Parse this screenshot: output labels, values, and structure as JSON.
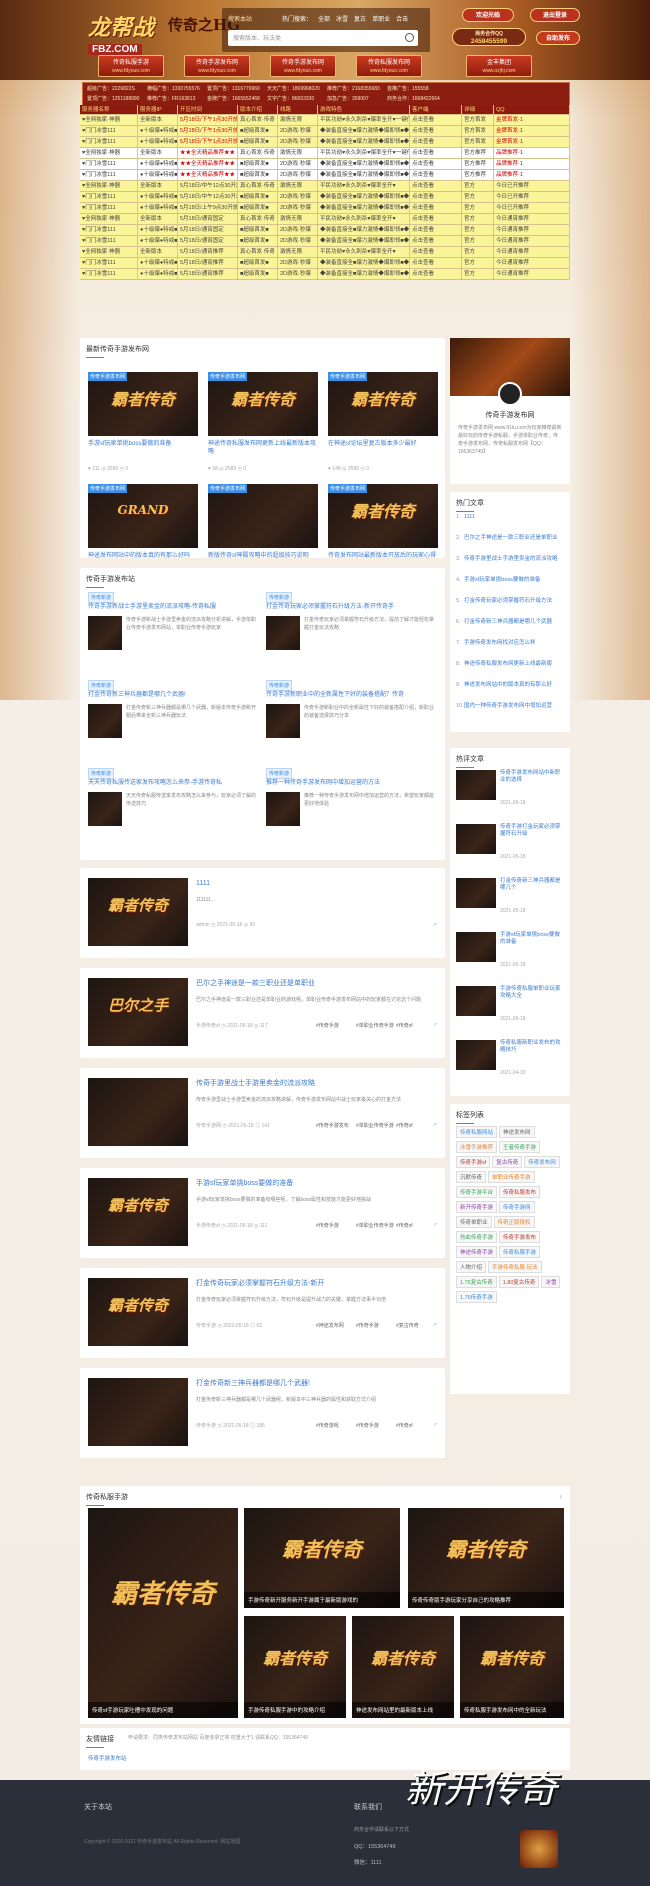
{
  "header": {
    "logo_text": "龙帮战",
    "logo_sub": "FBZ.COM",
    "logo2_text": "传奇之HG",
    "search_tab": "搜索本站",
    "hot_links": [
      "热门搜索：",
      "全部",
      "冰雪",
      "复古",
      "单职业",
      "合击"
    ],
    "search_placeholder": "搜索版本、玩法类",
    "btn_top": "欢迎光临",
    "btn_exit": "退出登录",
    "qq_label": "商务合作QQ",
    "qq_number": "2458455599",
    "btn_publish": "自助发布"
  },
  "nav": [
    {
      "label": "传奇私服手游",
      "url": "www.fdyouo.com"
    },
    {
      "label": "传奇手游发布网",
      "url": "www.fdyouo.com"
    },
    {
      "label": "传奇手游发布网",
      "url": "www.fdyouo.com"
    },
    {
      "label": "传奇私服发布网",
      "url": "www.fdyouo.com"
    },
    {
      "label": "金丰集团",
      "url": "www.ozjhj.com"
    }
  ],
  "ads": [
    [
      "超级广告：2226822S",
      "横幅广告：1330755576",
      "置顶广告：1316779969",
      "天天广告：1869968029",
      "推荐广告：2168355683",
      "首推广告：155558"
    ],
    [
      "置顶广告：1251188990",
      "推荐广告：FR163813",
      "金牌广告：1665552468",
      "文字广告：86653330",
      "加急广告：359007",
      "商务合作：1668422664"
    ]
  ],
  "table": {
    "headers": [
      "服务器名称",
      "服务器IP",
      "开区时间",
      "版本介绍",
      "线路",
      "游戏特色",
      "客户端",
      "详细",
      "QQ"
    ],
    "rows": [
      {
        "bg": "y",
        "cells": [
          "♥全网独家·神器",
          "全新版本",
          "5月18日/下午1点30开放",
          "真心首发·传奇",
          "激情无限",
          "平民功勋♥永久刺杀♥爆率全开♥一键传",
          "点击查看",
          "官方首发",
          "金牌首发·1"
        ],
        "red": true
      },
      {
        "bg": "y",
        "cells": [
          "♥门门冰雪111",
          "●十级爆●特戒■",
          "5月18日/下午1点30开放",
          "■超级首发■",
          "2D游戏·秒爆",
          "◆装备直接全■爆力激情◆爆即领■◆一键传",
          "点击查看",
          "官方首发",
          "金牌首发·1"
        ],
        "red": true
      },
      {
        "bg": "y",
        "cells": [
          "♥门门冰雪111",
          "●十级爆●特戒■",
          "5月18日/下午1点30开放",
          "■超级首发■",
          "2D游戏·秒爆",
          "◆装备直接全■爆力激情◆爆即领■◆一键传",
          "点击查看",
          "官方首发",
          "金牌首发·1"
        ],
        "red": true
      },
      {
        "bg": "w",
        "cells": [
          "♥全网独家·神器",
          "全新版本",
          "★★全天精品推荐★★",
          "真心首发·传奇",
          "激情无限",
          "平民功勋♥永久刺杀♥爆率全开♥一键传",
          "点击查看",
          "官方推荐",
          "品牌推荐·1"
        ],
        "red": true
      },
      {
        "bg": "w",
        "cells": [
          "♥门门冰雪111",
          "●十级爆●特戒■",
          "★★全天精品推荐★★",
          "■超级首发■",
          "2D游戏·秒爆",
          "◆装备直接全■爆力激情◆爆即领■◆一键传",
          "点击查看",
          "官方推荐",
          "品牌推荐·1"
        ],
        "red": true
      },
      {
        "bg": "w",
        "cells": [
          "♥门门冰雪111",
          "●十级爆●特戒■",
          "★★全天精品推荐★★",
          "■超级首发■",
          "2D游戏·秒爆",
          "◆装备直接全■爆力激情◆爆即领■◆一键传",
          "点击查看",
          "官方推荐",
          "品牌推荐·1"
        ],
        "red": true
      },
      {
        "bg": "y",
        "cells": [
          "♥全网独家·神器",
          "全新版本",
          "5月18日/中午12点30开放",
          "真心首发·传奇",
          "激情无限",
          "平民功勋♥永久刺杀♥爆率全开♥",
          "点击查看",
          "官方",
          "今日已开推荐"
        ],
        "red": false
      },
      {
        "bg": "y",
        "cells": [
          "♥门门冰雪111",
          "●十级爆●特戒■",
          "5月18日/中午12点30开放",
          "■超级首发■",
          "2D游戏·秒爆",
          "◆装备直接全■爆力激情◆爆即领■◆",
          "点击查看",
          "官方",
          "今日已开推荐"
        ],
        "red": false
      },
      {
        "bg": "y",
        "cells": [
          "♥门门冰雪111",
          "●十级爆●特戒■",
          "5月18日/上午9点30开放",
          "■超级首发■",
          "2D游戏·秒爆",
          "◆装备直接全■爆力激情◆爆即领■◆",
          "点击查看",
          "官方",
          "今日已开推荐"
        ],
        "red": false
      },
      {
        "bg": "y",
        "cells": [
          "♥全网独家·神器",
          "全新版本",
          "5月18日/通宵固定",
          "真心首发·传奇",
          "激情无限",
          "平民功勋♥永久刺杀♥爆率全开♥",
          "点击查看",
          "官方",
          "今日通宵推荐"
        ],
        "red": false
      },
      {
        "bg": "y",
        "cells": [
          "♥门门冰雪111",
          "●十级爆●特戒■",
          "5月18日/通宵固定",
          "■超级首发■",
          "2D游戏·秒爆",
          "◆装备直接全■爆力激情◆爆即领■◆",
          "点击查看",
          "官方",
          "今日通宵推荐"
        ],
        "red": false
      },
      {
        "bg": "y",
        "cells": [
          "♥门门冰雪111",
          "●十级爆●特戒■",
          "5月18日/通宵固定",
          "■超级首发■",
          "2D游戏·秒爆",
          "◆装备直接全■爆力激情◆爆即领■◆",
          "点击查看",
          "官方",
          "今日通宵推荐"
        ],
        "red": false
      },
      {
        "bg": "y",
        "cells": [
          "♥全网独家·神器",
          "全新版本",
          "5月18日/通宵推荐",
          "真心首发·传奇",
          "激情无限",
          "平民功勋♥永久刺杀♥爆率全开♥",
          "点击查看",
          "官方",
          "今日通宵推荐"
        ],
        "red": false
      },
      {
        "bg": "y",
        "cells": [
          "♥门门冰雪111",
          "●十级爆●特戒■",
          "5月18日/通宵推荐",
          "■超级首发■",
          "2D游戏·秒爆",
          "◆装备直接全■爆力激情◆爆即领■◆",
          "点击查看",
          "官方",
          "今日通宵推荐"
        ],
        "red": false
      },
      {
        "bg": "y",
        "cells": [
          "♥门门冰雪111",
          "●十级爆●特戒■",
          "5月18日/通宵推荐",
          "■超级首发■",
          "2D游戏·秒爆",
          "◆装备直接全■爆力激情◆爆即领■◆",
          "点击查看",
          "官方",
          "今日通宵推荐"
        ],
        "red": false
      }
    ]
  },
  "latest": {
    "title": "最新传奇手游发布网",
    "cards": [
      {
        "title": "手游sf玩家单挑boss要做的准备",
        "meta": "♥ 111  ◎ 2590  ◷ 0",
        "thumb": "霸者传奇",
        "tag": "传奇手游发布网"
      },
      {
        "title": "神途传奇私服发布网更新上线最新版本攻略",
        "meta": "♥ 58  ◎ 2589  ◷ 0",
        "thumb": "霸者传奇",
        "tag": "传奇手游发布网"
      },
      {
        "title": "在神途sf论坛里复古版本多少最好",
        "meta": "♥ 148  ◎ 2588  ◷ 0",
        "thumb": "霸者传奇",
        "tag": "传奇手游发布网"
      },
      {
        "title": "神途发布网站中的版本真的有那么好吗",
        "meta": "♥ 135  ◎ 2587  ◷ 0",
        "thumb": "GRAND",
        "tag": "传奇手游发布网"
      },
      {
        "title": "新版传奇sf神殿攻略中的超级技巧说明",
        "meta": "♥ 62  ◎ 2586  ◷ 0",
        "thumb": "",
        "tag": "传奇手游发布网"
      },
      {
        "title": "传奇发布网站最新版本开放后的玩家心得",
        "meta": "♥ 184  ◎ 2585  ◷ 0",
        "thumb": "霸者传奇",
        "tag": "传奇手游发布网"
      }
    ]
  },
  "pubsite": {
    "title": "传奇手游发布站",
    "items": [
      {
        "tag": "传奇新游",
        "title": "传奇手游新战士手游里卖金的流派攻略-传奇私服",
        "desc": "传奇手游新战士手游里卖金的流派攻略分析讲解，手游单职业传奇手游发布网站，单职业传奇手游玩家"
      },
      {
        "tag": "传奇新游",
        "title": "打金传奇玩家必须掌握符石升级方法-新开传奇手",
        "desc": "打金传奇玩家必须掌握符石升级方法，提前了解才能轻松掌握打金玩法攻略"
      },
      {
        "tag": "传奇新游",
        "title": "打金传奇新三神兵器都是哪几个武器!",
        "desc": "打金传奇新三神兵器都是哪几个武器，新版本传奇手游新开服后带来全新三神兵器玩法"
      },
      {
        "tag": "传奇新游",
        "title": "传奇手游新职业中的全新属性下好的装备搭配？传奇",
        "desc": "传奇手游新职业中的全新属性下好的装备搭配介绍，新职业的装备选择技巧分享"
      },
      {
        "tag": "传奇新游",
        "title": "天天传奇私服传送家发布攻略怎么来参-手游传奇私",
        "desc": "天天传奇私服传送家发布攻略怎么来参与，玩家必须了解的传送技巧"
      },
      {
        "tag": "传奇新游",
        "title": "推荐一种传奇手游发布网中增加运营的方法",
        "desc": "推荐一种传奇手游发布网中增加运营的方法，希望玩家都能更好地体验"
      }
    ]
  },
  "articles": [
    {
      "title": "1111",
      "desc": "111111...",
      "meta": "admin  ◷ 2021-05-18  ◎ 99",
      "thumb": "霸者传奇",
      "tags": []
    },
    {
      "title": "巴尔之手神途是一款三职业还是单职业",
      "desc": "巴尔之手神途是一款三职业还是单职业的游戏呢，单职业传奇手游发布网站中的玩家都在讨论这个问题",
      "meta": "手游传奇sf  ◷ 2021-05-18  ◎ 117",
      "thumb": "巴尔之手",
      "tags": [
        "#传奇手游",
        "#单职业传奇手游",
        "#传奇sf"
      ]
    },
    {
      "title": "传奇手游里战士手游里卖金的流派攻略",
      "desc": "传奇手游里战士手游里卖金的流派攻略讲解，传奇手游发布网站中战士玩家最关心的打金方法",
      "meta": "传奇手游网  ◷ 2021-05-18  ◎ 141",
      "thumb": "",
      "tags": [
        "#传奇手游发布",
        "#单职业传奇手游",
        "#传奇sf"
      ]
    },
    {
      "title": "手游sf玩家单挑boss要做的准备",
      "desc": "手游sf玩家单挑boss要做的准备有哪些呢，了解boss属性和技能才能更好地挑战",
      "meta": "手游传奇sf  ◷ 2021-05-18  ◎ 111",
      "thumb": "霸者传奇",
      "tags": [
        "#传奇手游",
        "#单职业传奇手游",
        "#传奇sf"
      ]
    },
    {
      "title": "打金传奇玩家必须掌握符石升级方法-新开",
      "desc": "打金传奇玩家必须掌握符石升级方法，符石升级是提升战力的关键，掌握方法事半功倍",
      "meta": "传奇手游  ◷ 2021-05-18  ◎ 63",
      "thumb": "霸者传奇",
      "tags": [
        "#神途发布网",
        "#传奇手游",
        "#复古传奇"
      ]
    },
    {
      "title": "打金传奇新三神兵器都是哪几个武器!",
      "desc": "打金传奇新三神兵器都是哪几个武器呢，新版本中三神兵器的属性和获取方式介绍",
      "meta": "传奇手游  ◷ 2021-05-18  ◎ 185",
      "thumb": "",
      "tags": [
        "#传奇游戏",
        "#传奇手游",
        "#传奇sf"
      ]
    }
  ],
  "sidebar": {
    "site_name": "传奇手游发布网",
    "site_desc": "传奇手游发布网 www.91lu.com为玩家推荐最新最好玩的传奇手游私服，手游单职业传奇，传奇手游发布网，传奇私服发布网【QQ：155363749】",
    "hot_title": "热门文章",
    "hot_list": [
      "1111",
      "巴尔之手神途是一款三职业还是单职业",
      "传奇手游里战士手游里卖金的流派攻略",
      "手游sf玩家单挑boss要做的准备",
      "打金传奇玩家必须掌握符石升级方法",
      "打金传奇新三神兵器都是哪几个武器",
      "手游传奇发布网找对应怎么样",
      "神途传奇私服发布网更新上线最新版",
      "神途发布网站中的版本真的有那么好",
      "国内一种传奇手游发布网中增加运营"
    ],
    "hot2_title": "热评文章",
    "hot2_list": [
      {
        "title": "传奇手游发布网站中新职业的选择",
        "date": "2021-05-18"
      },
      {
        "title": "传奇手游打金玩家必须掌握符石升级",
        "date": "2021-05-18"
      },
      {
        "title": "打金传奇新三神兵器都是哪几个",
        "date": "2021-05-18"
      },
      {
        "title": "手游sf玩家单挑boss要做的准备",
        "date": "2021-05-18"
      },
      {
        "title": "手游传奇私服单职业玩家攻略大全",
        "date": "2021-05-18"
      },
      {
        "title": "传奇私服新职业发布的攻略技巧",
        "date": "2021-04-30"
      }
    ],
    "tags_title": "标签列表",
    "tags": [
      "传奇私服网站",
      "神途发布网",
      "冰雪手游推荐",
      "王者传奇手游",
      "传奇手游sf",
      "复古传奇",
      "传奇发布网",
      "沉默传奇",
      "单职业传奇手游",
      "传奇手游平台",
      "传奇私服发布",
      "新开传奇手游",
      "传奇手游网",
      "传奇单职业",
      "传奇正版授权",
      "热血传奇手游",
      "传奇手游发布",
      "神途传奇手游",
      "传奇私服手游",
      "人物介绍",
      "手游传奇私服 玩法",
      "1.76复古传奇",
      "1.80复古传奇",
      "冰雪",
      "1.76传奇手游"
    ]
  },
  "private": {
    "title": "传奇私服手游",
    "cards": [
      {
        "title": "传奇sf手游玩家吐槽中发现的问题",
        "big": true
      },
      {
        "title": "手游传奇新开服务新开手游属于最新版游戏的",
        "big": false
      },
      {
        "title": "传奇传奇版手游玩家分享自己的攻略推荐",
        "big": false
      },
      {
        "title": "手游传奇私服手游中的攻略介绍",
        "big": false
      },
      {
        "title": "神途发布网站里的最新版本上线",
        "big": false
      },
      {
        "title": "传奇私服手游发布网中的全新玩法",
        "big": false
      }
    ]
  },
  "friends": {
    "title": "友情链接",
    "desc": "申请要求：同类传奇发布站网站 百度收录正常 权重大于1 请联系QQ：155364749",
    "link": "传奇手游发布站"
  },
  "footer": {
    "about": "关于本站",
    "copyright": "Copyright © 2020-2021 传奇手游发布站 All Rights Reserved. 网站地图",
    "contact": "联系我们",
    "contact_desc": "商务合作请联系以下方式",
    "qq": "QQ：155364749",
    "wx": "微信：1111",
    "watermark": "新开传奇"
  }
}
